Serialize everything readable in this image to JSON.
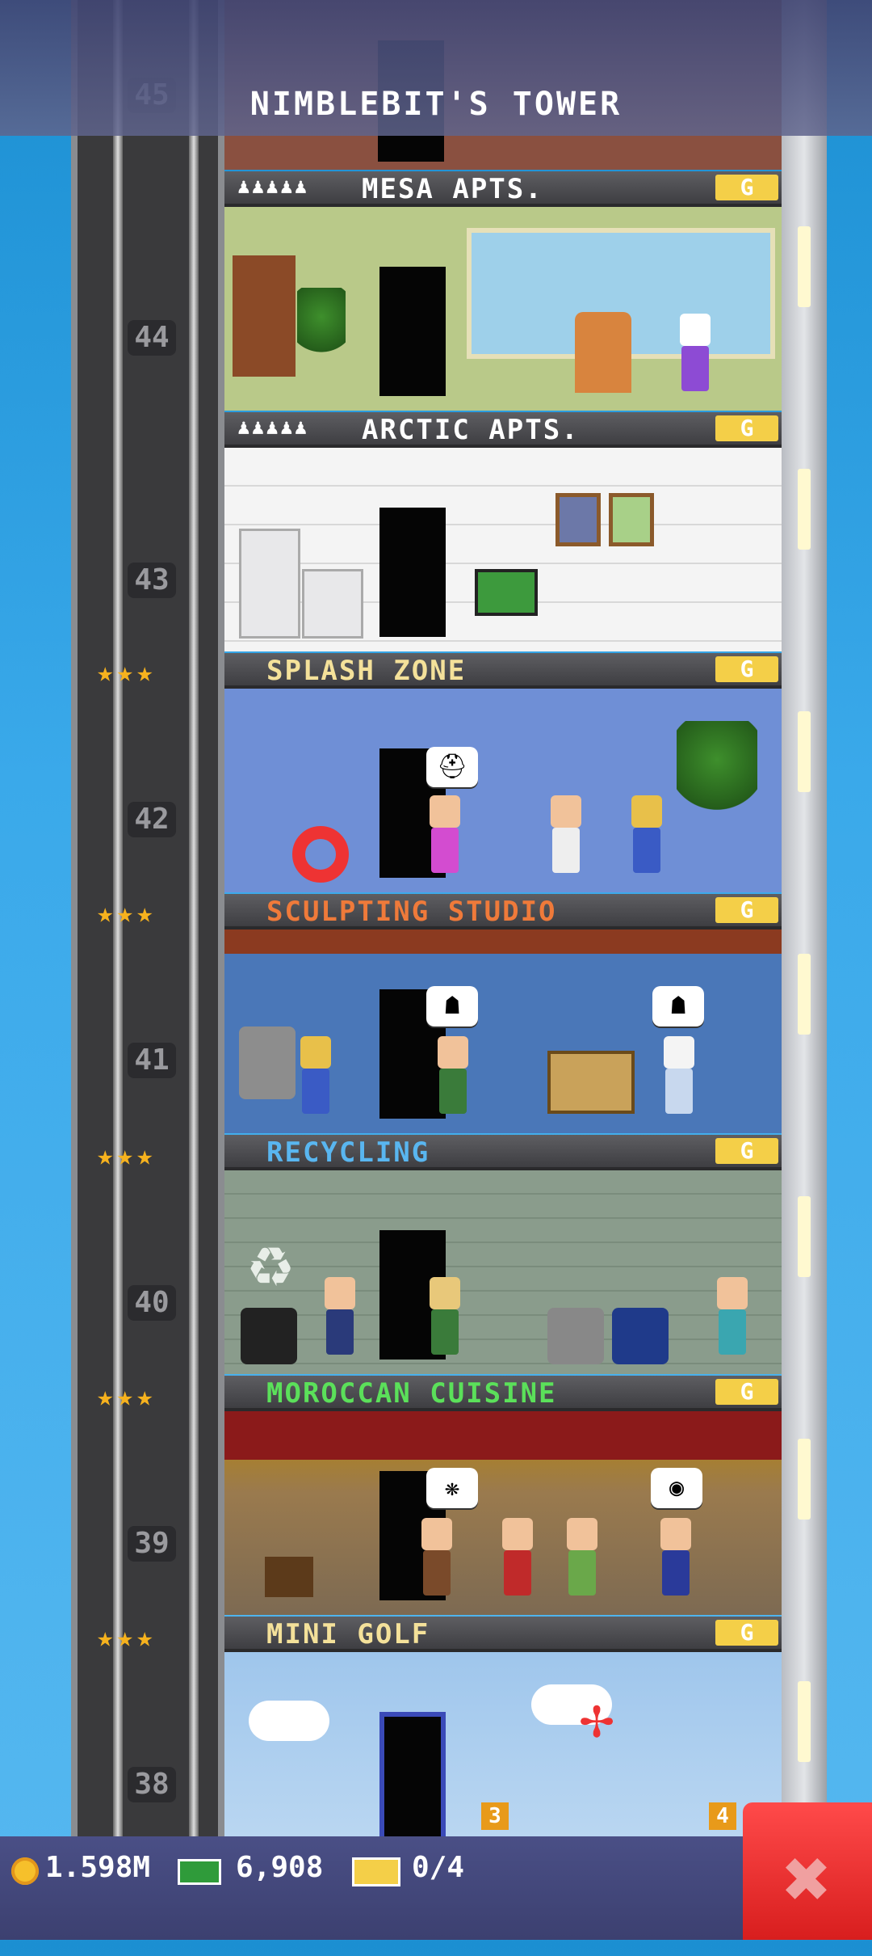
{
  "header": {
    "title": "NIMBLEBIT'S TOWER",
    "top_floor_number": "45"
  },
  "floors": [
    {
      "number": "44",
      "name": "MESA APTS.",
      "type": "residential",
      "name_color": "#ffffff",
      "badge": "G",
      "people_icons": "♟♟♟♟♟"
    },
    {
      "number": "43",
      "name": "ARCTIC APTS.",
      "type": "residential",
      "name_color": "#ffffff",
      "badge": "G",
      "people_icons": "♟♟♟♟♟"
    },
    {
      "number": "42",
      "name": "SPLASH ZONE",
      "type": "business",
      "name_color": "#f4e19a",
      "badge": "G",
      "stars": "★★★"
    },
    {
      "number": "41",
      "name": "SCULPTING STUDIO",
      "type": "business",
      "name_color": "#ef7a3a",
      "badge": "G",
      "stars": "★★★"
    },
    {
      "number": "40",
      "name": "RECYCLING",
      "type": "business",
      "name_color": "#59b6f0",
      "badge": "G",
      "stars": "★★★"
    },
    {
      "number": "39",
      "name": "MOROCCAN CUISINE",
      "type": "business",
      "name_color": "#5be05a",
      "badge": "G",
      "stars": "★★★"
    },
    {
      "number": "38",
      "name": "MINI GOLF",
      "type": "business",
      "name_color": "#f4e19a",
      "badge": "G",
      "stars": "★★★"
    }
  ],
  "room_markers": {
    "left": "3",
    "right": "4"
  },
  "status_bar": {
    "coins": "1.598M",
    "bux": "6,908",
    "tickets": "0/4"
  },
  "colors": {
    "close_button": "#e52b2b",
    "bottom_bar": "#434879",
    "badge": "#f4cf48"
  }
}
